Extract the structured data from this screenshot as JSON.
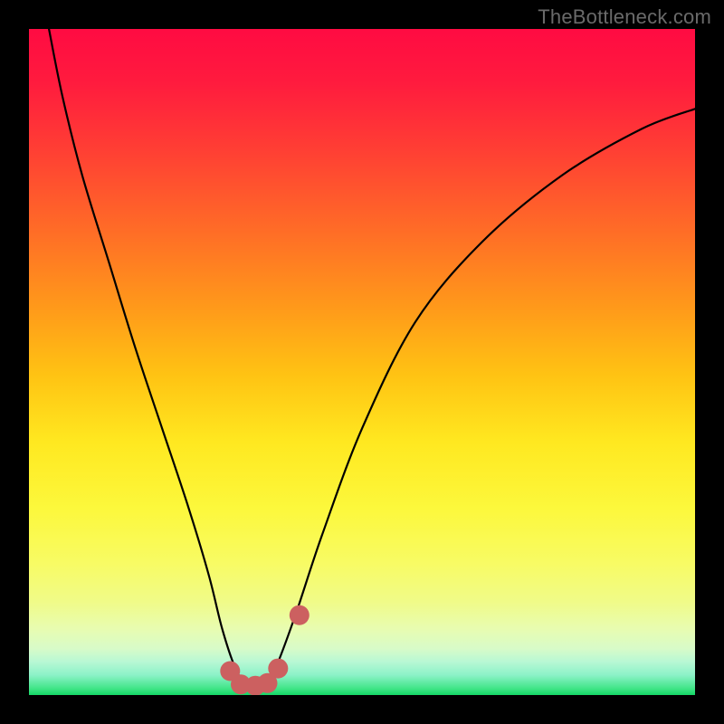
{
  "watermark": {
    "text": "TheBottleneck.com"
  },
  "chart_data": {
    "type": "line",
    "title": "",
    "xlabel": "",
    "ylabel": "",
    "xlim": [
      0,
      100
    ],
    "ylim": [
      0,
      100
    ],
    "grid": false,
    "series": [
      {
        "name": "bottleneck-curve",
        "x": [
          3,
          5,
          8,
          12,
          16,
          20,
          24,
          27,
          29,
          31,
          33,
          35,
          37,
          40,
          44,
          50,
          58,
          68,
          80,
          92,
          100
        ],
        "values": [
          100,
          90,
          78,
          65,
          52,
          40,
          28,
          18,
          10,
          4,
          1,
          1,
          4,
          12,
          24,
          40,
          56,
          68,
          78,
          85,
          88
        ]
      }
    ],
    "highlights": [
      {
        "name": "trough-point-1",
        "x": 30.2,
        "y": 3.6
      },
      {
        "name": "trough-point-2",
        "x": 31.8,
        "y": 1.6
      },
      {
        "name": "trough-point-3",
        "x": 34.0,
        "y": 1.4
      },
      {
        "name": "trough-point-4",
        "x": 35.8,
        "y": 1.8
      },
      {
        "name": "trough-point-5",
        "x": 37.4,
        "y": 4.0
      },
      {
        "name": "trough-point-6",
        "x": 40.6,
        "y": 12.0
      }
    ],
    "highlight_color": "#cc6060",
    "background_gradient": {
      "top": "#ff0b42",
      "mid": "#ffd21a",
      "bottom": "#14d766"
    }
  }
}
